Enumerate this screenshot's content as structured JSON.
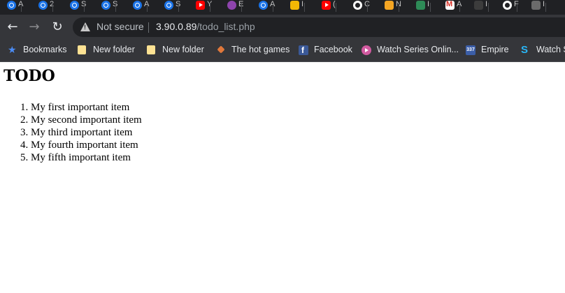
{
  "tabs": [
    {
      "icon": "blue-circle-icon",
      "label": "A"
    },
    {
      "icon": "blue-circle-icon",
      "label": "2"
    },
    {
      "icon": "blue-circle-icon",
      "label": "S"
    },
    {
      "icon": "blue-circle-icon",
      "label": "S"
    },
    {
      "icon": "blue-circle-icon",
      "label": "A"
    },
    {
      "icon": "blue-circle-icon",
      "label": "S"
    },
    {
      "icon": "youtube-icon",
      "label": "Y"
    },
    {
      "icon": "purple-circle-icon",
      "label": "E"
    },
    {
      "icon": "blue-circle-icon",
      "label": "A"
    },
    {
      "icon": "book-icon",
      "label": "I"
    },
    {
      "icon": "youtube-icon",
      "label": "("
    },
    {
      "icon": "github-icon",
      "label": "C"
    },
    {
      "icon": "orange-square-icon",
      "label": "N"
    },
    {
      "icon": "green-square-icon",
      "label": "I"
    },
    {
      "icon": "gmail-icon",
      "label": "A"
    },
    {
      "icon": "dark-square-icon",
      "label": "I"
    },
    {
      "icon": "github-icon",
      "label": "F"
    },
    {
      "icon": "gray-square-icon",
      "label": "I"
    }
  ],
  "toolbar": {
    "back_label": "←",
    "forward_label": "→",
    "reload_label": "↻",
    "security_text": "Not secure",
    "url_host": "3.90.0.89",
    "url_path": "/todo_list.php"
  },
  "bookmarks": [
    {
      "icon": "star-icon",
      "label": "Bookmarks"
    },
    {
      "icon": "folder-icon",
      "label": "New folder"
    },
    {
      "icon": "folder-icon",
      "label": "New folder"
    },
    {
      "icon": "game-icon",
      "label": "The hot games"
    },
    {
      "icon": "facebook-icon",
      "label": "Facebook"
    },
    {
      "icon": "play-icon",
      "label": "Watch Series Onlin..."
    },
    {
      "icon": "empire-icon",
      "label": "Empire"
    },
    {
      "icon": "s-icon",
      "label": "Watch S"
    }
  ],
  "page": {
    "heading": "TODO",
    "items": [
      "My first important item",
      "My second important item",
      "My third important item",
      "My fourth important item",
      "My fifth important item"
    ]
  },
  "colors": {
    "tab_strip": "#202124",
    "toolbar": "#35363a",
    "omnibox": "#202124",
    "page_bg": "#ffffff"
  }
}
